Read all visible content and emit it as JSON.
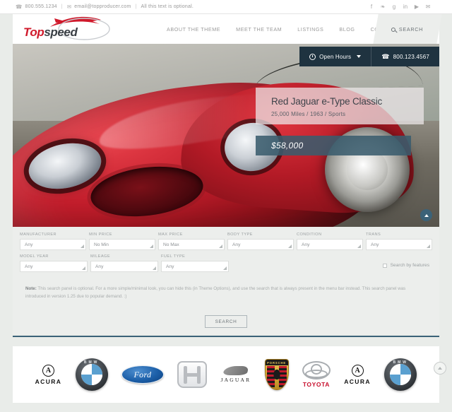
{
  "topbar": {
    "phone": "800.555.1234",
    "email": "email@topproducer.com",
    "tagline": "All this text is optional.",
    "sep": "|",
    "social": [
      {
        "name": "facebook-icon",
        "glyph": "f"
      },
      {
        "name": "twitter-icon",
        "glyph": "❧"
      },
      {
        "name": "googleplus-icon",
        "glyph": "g"
      },
      {
        "name": "linkedin-icon",
        "glyph": "in"
      },
      {
        "name": "youtube-icon",
        "glyph": "▶"
      },
      {
        "name": "envelope-icon",
        "glyph": "✉"
      }
    ]
  },
  "header": {
    "logo_top": "Top",
    "logo_speed": "speed",
    "nav": [
      {
        "label": "ABOUT THE THEME"
      },
      {
        "label": "MEET THE TEAM"
      },
      {
        "label": "LISTINGS"
      },
      {
        "label": "BLOG"
      },
      {
        "label": "CONTACT US"
      }
    ],
    "search_label": "SEARCH"
  },
  "hero": {
    "open_hours_label": "Open Hours",
    "phone": "800.123.4567",
    "title": "Red Jaguar e-Type Classic",
    "subtitle": "25,000 Miles  /  1963  /  Sports",
    "price": "$58,000"
  },
  "search_panel": {
    "filters_row1": [
      {
        "label": "MANUFACTURER",
        "value": "Any"
      },
      {
        "label": "MIN PRICE",
        "value": "No Min"
      },
      {
        "label": "MAX PRICE",
        "value": "No Max"
      },
      {
        "label": "BODY TYPE",
        "value": "Any"
      },
      {
        "label": "CONDITION",
        "value": "Any"
      },
      {
        "label": "TRANS",
        "value": "Any"
      }
    ],
    "filters_row2": [
      {
        "label": "MODEL YEAR",
        "value": "Any"
      },
      {
        "label": "MILEAGE",
        "value": "Any"
      },
      {
        "label": "FUEL TYPE",
        "value": "Any"
      }
    ],
    "features_checkbox_label": "Search by features",
    "note_prefix": "Note:",
    "note_text": " This search panel is optional. For a more simple/minimal look, you can hide this (in Theme Options), and use the search that is always present in the menu bar instead. This search panel was introduced in version 1.25 due to popular demand. :)",
    "submit_label": "SEARCH"
  },
  "brands": [
    {
      "name": "acura",
      "label": "ACURA"
    },
    {
      "name": "bmw",
      "label": "BMW"
    },
    {
      "name": "ford",
      "label": "Ford"
    },
    {
      "name": "honda",
      "label": "Honda"
    },
    {
      "name": "jaguar",
      "label": "JAGUAR"
    },
    {
      "name": "porsche",
      "label": "PORSCHE"
    },
    {
      "name": "toyota",
      "label": "TOYOTA"
    },
    {
      "name": "acura2",
      "label": "ACURA"
    },
    {
      "name": "bmw2",
      "label": "BMW"
    }
  ],
  "colors": {
    "accent_red": "#d0192b",
    "dark_teal": "#1f3340",
    "price_band": "#3a5c6d",
    "divider": "#3b6278",
    "panel_bg": "#eceeec"
  }
}
